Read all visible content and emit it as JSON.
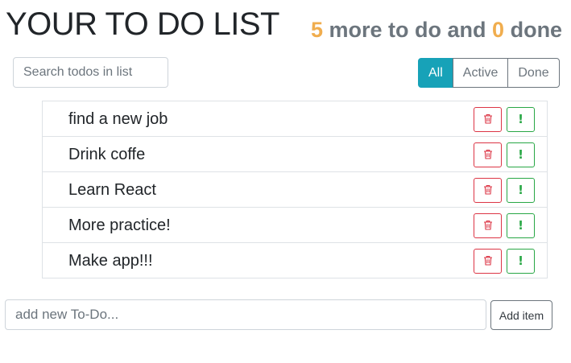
{
  "header": {
    "title": "YOUR TO DO LIST",
    "todo_count": "5",
    "todo_text": " more to do and ",
    "done_count": "0",
    "done_text": " done"
  },
  "search": {
    "placeholder": "Search todos in list",
    "value": ""
  },
  "filters": [
    {
      "label": "All",
      "active": true
    },
    {
      "label": "Active",
      "active": false
    },
    {
      "label": "Done",
      "active": false
    }
  ],
  "todos": [
    {
      "label": "find a new job"
    },
    {
      "label": "Drink coffe"
    },
    {
      "label": "Learn React"
    },
    {
      "label": "More practice!"
    },
    {
      "label": "Make app!!!"
    }
  ],
  "todo_actions": {
    "delete_icon": "trash-icon",
    "important_icon": "exclamation-icon",
    "important_glyph": "!"
  },
  "add_form": {
    "placeholder": "add new To-Do...",
    "value": "",
    "button_label": "Add item"
  },
  "colors": {
    "accent": "#f0ad4e",
    "muted": "#6c757d",
    "filter_active": "#17a2b8",
    "danger": "#dc3545",
    "success": "#28a745"
  }
}
